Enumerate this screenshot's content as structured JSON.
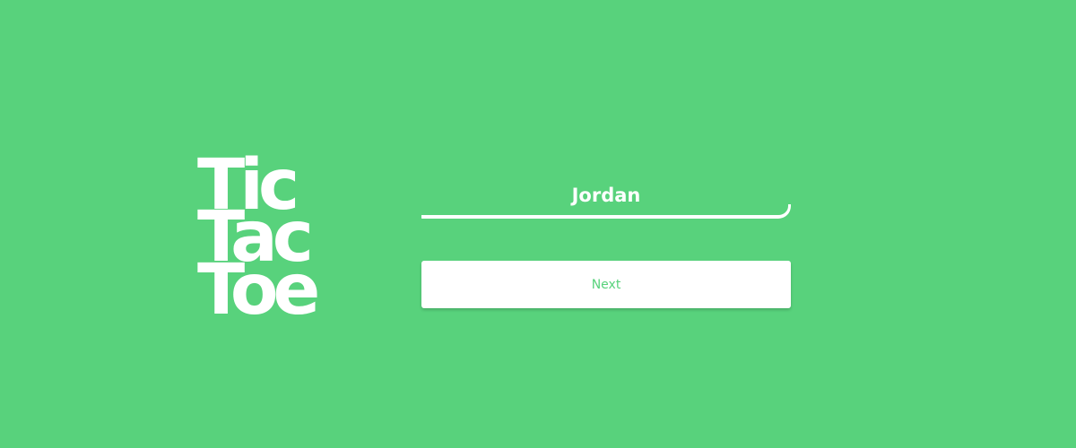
{
  "logo": {
    "line1": "Tic",
    "line2": "Tac",
    "line3": "Toe"
  },
  "name_field": {
    "value": "Jordan"
  },
  "next_button": {
    "label": "Next"
  },
  "colors": {
    "background": "#58d27c",
    "foreground": "#ffffff",
    "button_text": "#58d27c"
  }
}
